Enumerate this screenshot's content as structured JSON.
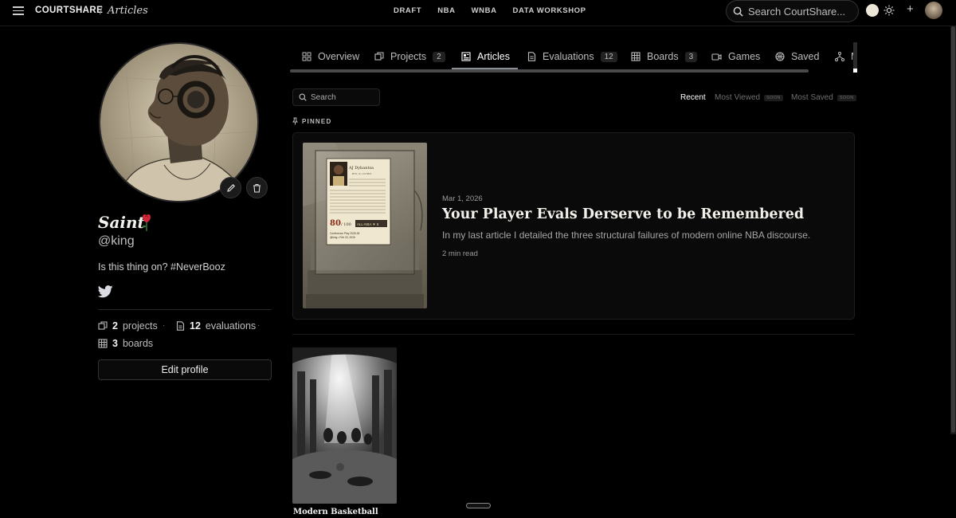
{
  "topbar": {
    "brand": "COURTSHARE",
    "crumb_separator": "/",
    "crumb": "Articles",
    "nav": [
      "DRAFT",
      "NBA",
      "WNBA",
      "DATA WORKSHOP"
    ],
    "search_placeholder": "Search CourtShare...",
    "plus_label": "+"
  },
  "profile": {
    "name": "Saint",
    "handle": "@king",
    "bio": "Is this thing on? #NeverBooz",
    "stats": {
      "projects_count": "2",
      "projects_label": "projects",
      "evaluations_count": "12",
      "evaluations_label": "evaluations",
      "boards_count": "3",
      "boards_label": "boards"
    },
    "dot": "·",
    "edit_profile": "Edit profile"
  },
  "tabs": [
    {
      "label": "Overview",
      "count": ""
    },
    {
      "label": "Projects",
      "count": "2"
    },
    {
      "label": "Articles",
      "count": ""
    },
    {
      "label": "Evaluations",
      "count": "12"
    },
    {
      "label": "Boards",
      "count": "3"
    },
    {
      "label": "Games",
      "count": ""
    },
    {
      "label": "Saved",
      "count": ""
    },
    {
      "label": "M",
      "count": ""
    }
  ],
  "articles": {
    "search_placeholder": "Search",
    "sort": {
      "recent": "Recent",
      "most_viewed": "Most Viewed",
      "most_saved": "Most Saved",
      "soon": "SOON"
    },
    "pinned_label": "PINNED",
    "pinned": {
      "date": "Mar 1, 2026",
      "title": "Your Player Evals Derserve to be Remembered",
      "excerpt": "In my last article I detailed the three structural failures of modern online NBA discourse.",
      "read_time": "2 min read",
      "card": {
        "name": "AJ Dybantsa",
        "meta": "BYU • F • CV 98.2",
        "score": "80",
        "score_total": "/ 100",
        "tier": "ALL-NBA ▼ 8",
        "footer1": "Conference Play 2025-26",
        "footer2": "@king • Feb 23, 2026"
      }
    },
    "second": {
      "title": "Modern Basketball"
    }
  },
  "colors": {
    "background": "#000000",
    "text": "#e8e6e1",
    "accent_underline": "#8a8f96"
  }
}
